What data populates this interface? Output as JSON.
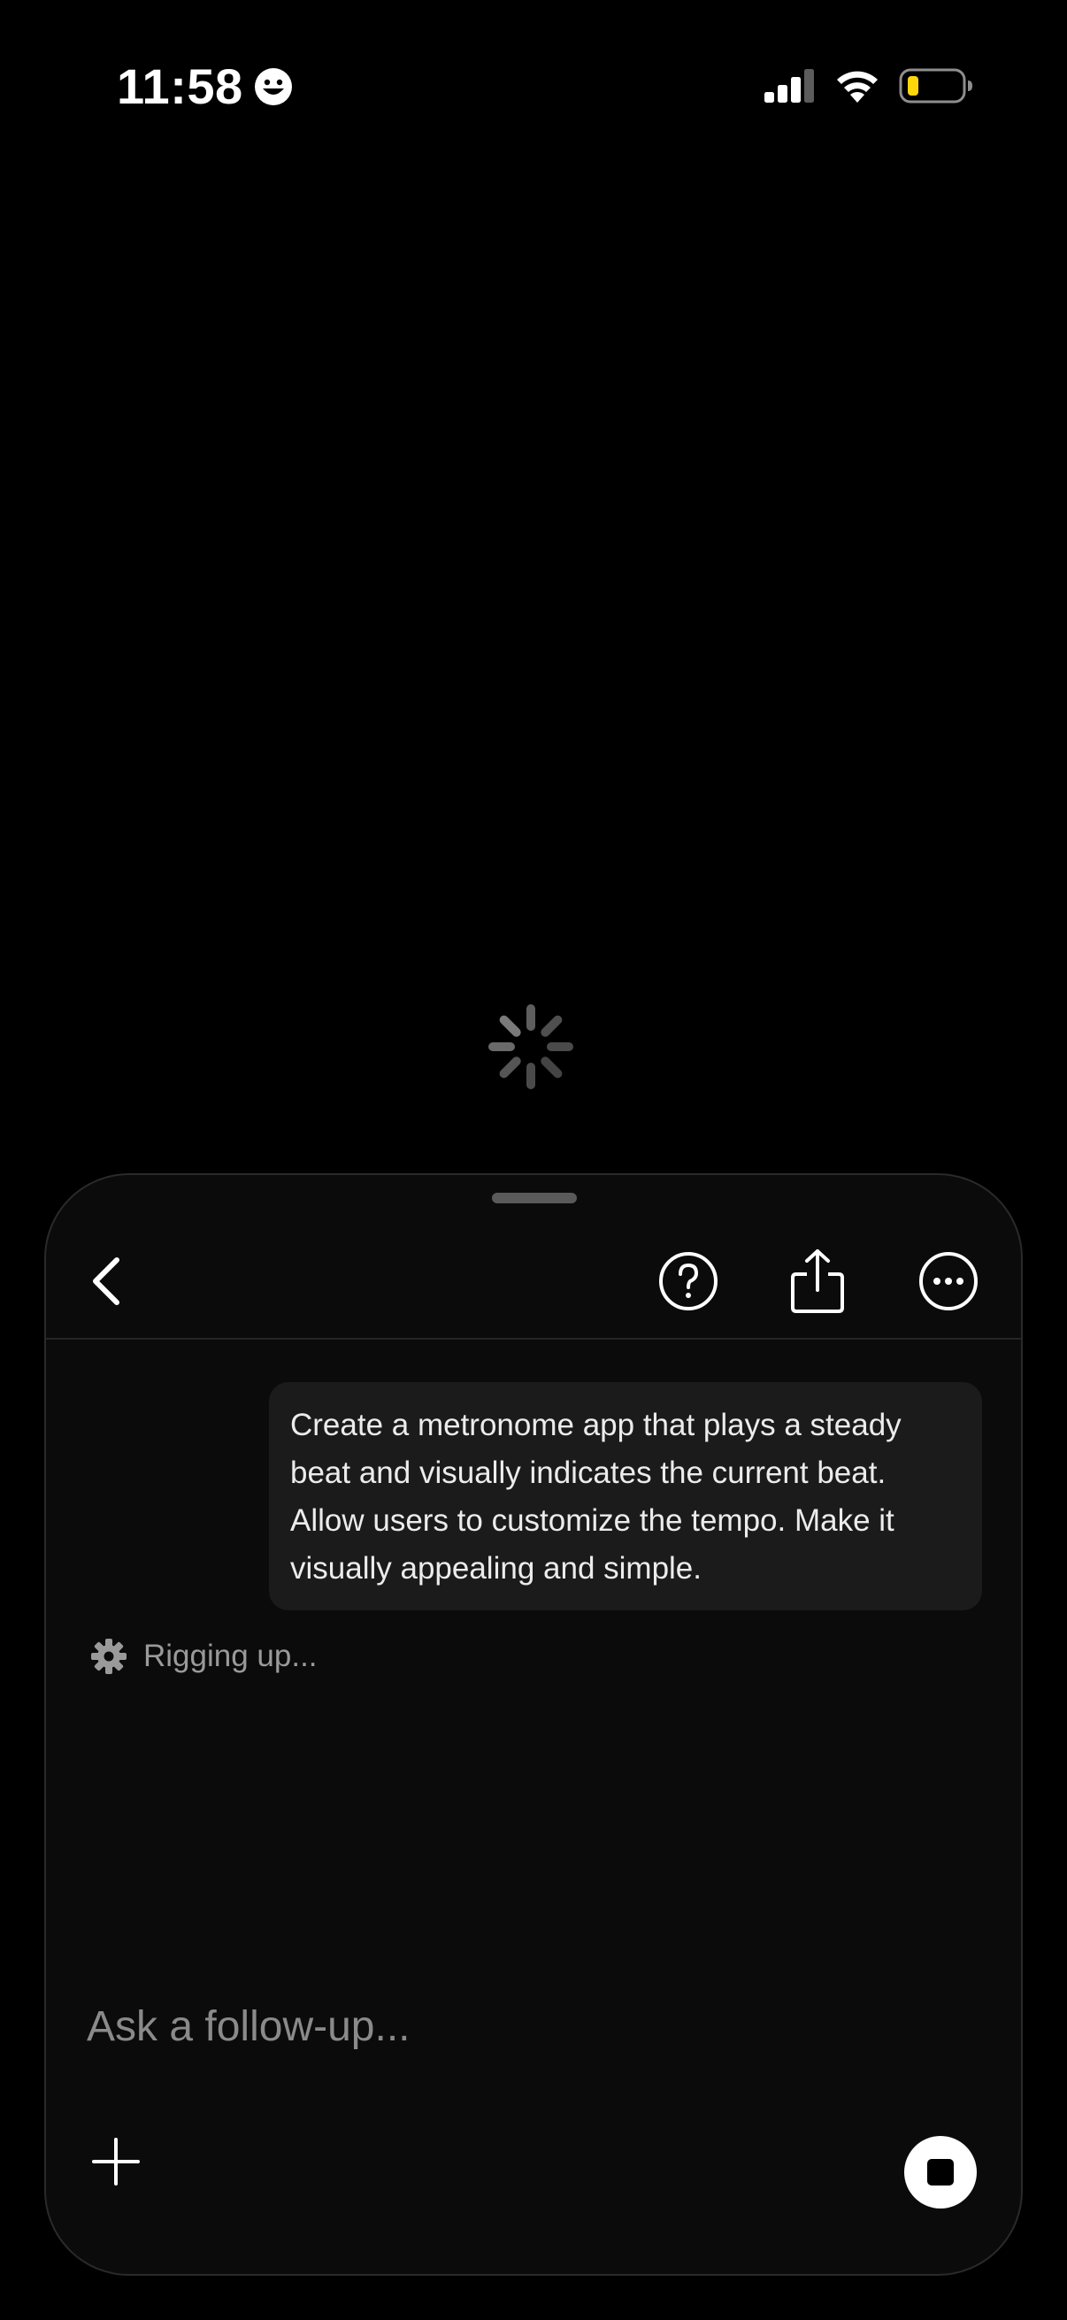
{
  "status_bar": {
    "time": "11:58",
    "emoji_icon": "smiling-face-icon",
    "signal_icon": "cellular-signal-icon",
    "wifi_icon": "wifi-icon",
    "battery_icon": "battery-low-icon",
    "battery_color": "#ffd60a"
  },
  "loading": {
    "icon": "loading-spinner-icon"
  },
  "sheet": {
    "header": {
      "back_icon": "chevron-left-icon",
      "help_icon": "question-circle-icon",
      "share_icon": "share-icon",
      "more_icon": "ellipsis-circle-icon"
    },
    "user_message": "Create a metronome app that plays a steady beat and visually indicates the current beat. Allow users to customize the tempo. Make it visually appealing and simple.",
    "status": {
      "icon": "gear-icon",
      "text": "Rigging up..."
    },
    "input": {
      "value": "",
      "placeholder": "Ask a follow-up..."
    },
    "add_icon": "plus-icon",
    "stop_icon": "stop-icon"
  }
}
